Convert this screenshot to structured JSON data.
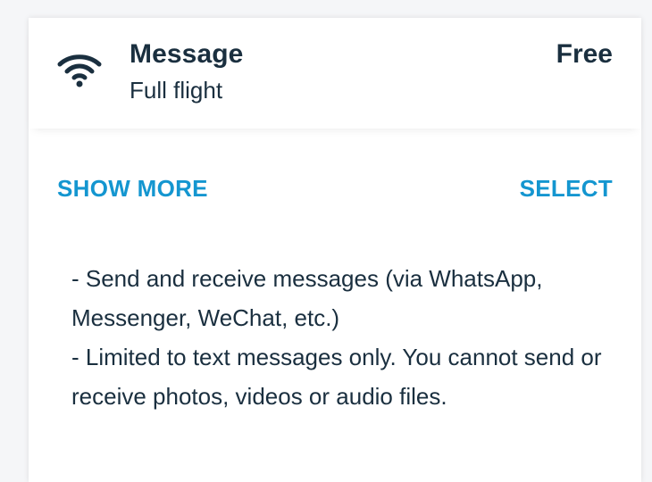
{
  "item": {
    "icon": "wifi-icon",
    "title": "Message",
    "subtitle": "Full flight",
    "price": "Free"
  },
  "actions": {
    "show_more": "SHOW MORE",
    "select": "SELECT"
  },
  "description": {
    "line1": "- Send and receive messages (via WhatsApp, Messenger, WeChat, etc.)",
    "line2": "- Limited to text messages only. You cannot send or receive photos, videos or audio files."
  },
  "colors": {
    "text": "#1a2f3f",
    "accent": "#1496d0"
  }
}
